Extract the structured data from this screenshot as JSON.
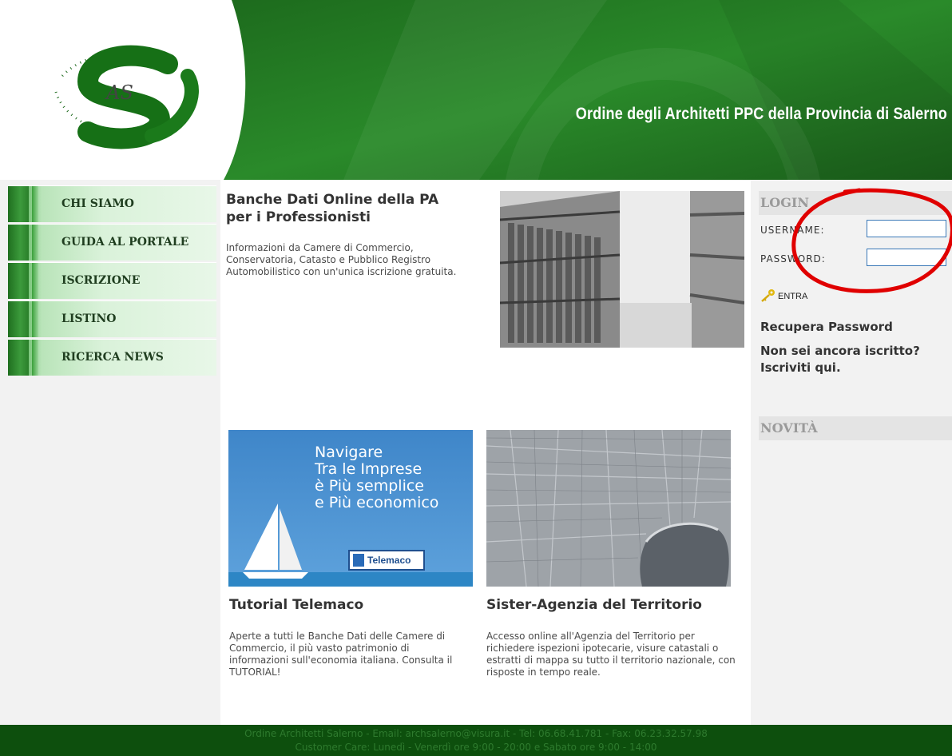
{
  "header": {
    "site_title": "Ordine degli Architetti PPC della Provincia di Salerno",
    "logo_initials": "AS",
    "brand_green": "#1f7a1f"
  },
  "nav": {
    "items": [
      {
        "label": "CHI SIAMO"
      },
      {
        "label": "GUIDA AL PORTALE"
      },
      {
        "label": "ISCRIZIONE"
      },
      {
        "label": "LISTINO"
      },
      {
        "label": "RICERCA NEWS"
      }
    ]
  },
  "main": {
    "intro": {
      "title": "Banche Dati Online della PA per i Professionisti",
      "text": "Informazioni da Camere di Commercio, Conservatoria, Catasto e Pubblico Registro Automobilistico con un'unica iscrizione gratuita."
    },
    "telemaco_banner": {
      "lines": [
        "Navigare",
        "Tra le Imprese",
        "è Più semplice",
        "e Più economico"
      ],
      "badge": "Telemaco"
    },
    "cards": [
      {
        "title": "Tutorial Telemaco",
        "text": "Aperte a tutti le Banche Dati delle Camere di Commercio, il più vasto patrimonio di informazioni sull'economia italiana. Consulta il TUTORIAL!"
      },
      {
        "title": "Sister-Agenzia del Territorio",
        "text": "Accesso online all'Agenzia del Territorio per richiedere ispezioni ipotecarie, visure catastali o estratti di mappa su tutto il territorio nazionale, con risposte in tempo reale."
      }
    ]
  },
  "login": {
    "heading": "LOGIN",
    "username_label": "USERNAME:",
    "username_value": "",
    "password_label": "PASSWORD:",
    "password_value": "",
    "submit_label": "ENTRA",
    "recover_link": "Recupera Password",
    "register_link_1": "Non sei ancora iscritto?",
    "register_link_2": "Iscriviti qui."
  },
  "news": {
    "heading": "NOVITÀ"
  },
  "footer": {
    "line1": "Ordine Architetti Salerno - Email: archsalerno@visura.it - Tel: 06.68.41.781 - Fax: 06.23.32.57.98",
    "line2": "Customer Care: Lunedì - Venerdì ore 9:00 - 20:00 e Sabato ore 9:00 - 14:00"
  },
  "annotation": {
    "color": "#e00000"
  }
}
